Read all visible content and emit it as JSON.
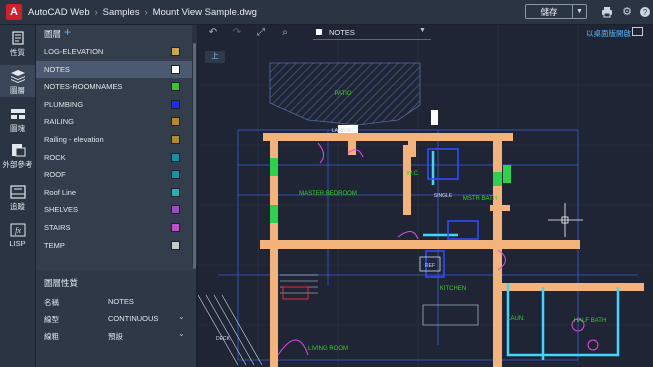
{
  "app": {
    "name": "AutoCAD Web",
    "breadcrumb": [
      "Samples",
      "Mount View Sample.dwg"
    ]
  },
  "header": {
    "save_label": "儲存",
    "icons": [
      "print-icon",
      "settings-icon",
      "help-icon"
    ]
  },
  "leftrail": {
    "items": [
      {
        "label": "性質",
        "icon": "properties-icon"
      },
      {
        "label": "圖層",
        "icon": "layers-icon"
      },
      {
        "label": "圖塊",
        "icon": "blocks-icon"
      },
      {
        "label": "外部參考",
        "icon": "xref-icon"
      },
      {
        "label": "追蹤",
        "icon": "trace-icon"
      },
      {
        "label": "LISP",
        "icon": "lisp-icon"
      }
    ]
  },
  "layers_panel": {
    "title": "圖層",
    "items": [
      {
        "name": "LOG-ELEVATION",
        "color": "#c9a94f"
      },
      {
        "name": "NOTES",
        "color": "#ffffff"
      },
      {
        "name": "NOTES-ROOMNAMES",
        "color": "#3fbf2a"
      },
      {
        "name": "PLUMBING",
        "color": "#1f2fe0"
      },
      {
        "name": "RAILING",
        "color": "#b08a2e"
      },
      {
        "name": "Railing - elevation",
        "color": "#b08a2e"
      },
      {
        "name": "ROCK",
        "color": "#1a8fa0"
      },
      {
        "name": "ROOF",
        "color": "#1a8fa0"
      },
      {
        "name": "Roof Line",
        "color": "#2ab0a8"
      },
      {
        "name": "SHELVES",
        "color": "#9a4fc0"
      },
      {
        "name": "STAIRS",
        "color": "#c050c8"
      },
      {
        "name": "TEMP",
        "color": "#c8c8c8"
      }
    ],
    "active_index": 1
  },
  "layer_props": {
    "title": "圖層性質",
    "rows": [
      {
        "key": "名稱",
        "value": "NOTES"
      },
      {
        "key": "線型",
        "value": "CONTINUOUS"
      },
      {
        "key": "線粗",
        "value": "預設"
      }
    ]
  },
  "canvas": {
    "current_layer": "NOTES",
    "read_only_label": "以桌面版開啟",
    "view_label": "上",
    "room_labels": [
      "PATIO",
      "MASTER BEDROOM",
      "W.C.",
      "MSTR BATH",
      "KITCHEN",
      "LAUN.",
      "HALF BATH",
      "LIVING ROOM",
      "REF",
      "SINGLE",
      "LANDING",
      "DECK"
    ]
  },
  "colors": {
    "accent": "#58b6ff",
    "wall": "#f4b37a",
    "room_text": "#39d12a",
    "cyan_line": "#3fd6ff"
  }
}
